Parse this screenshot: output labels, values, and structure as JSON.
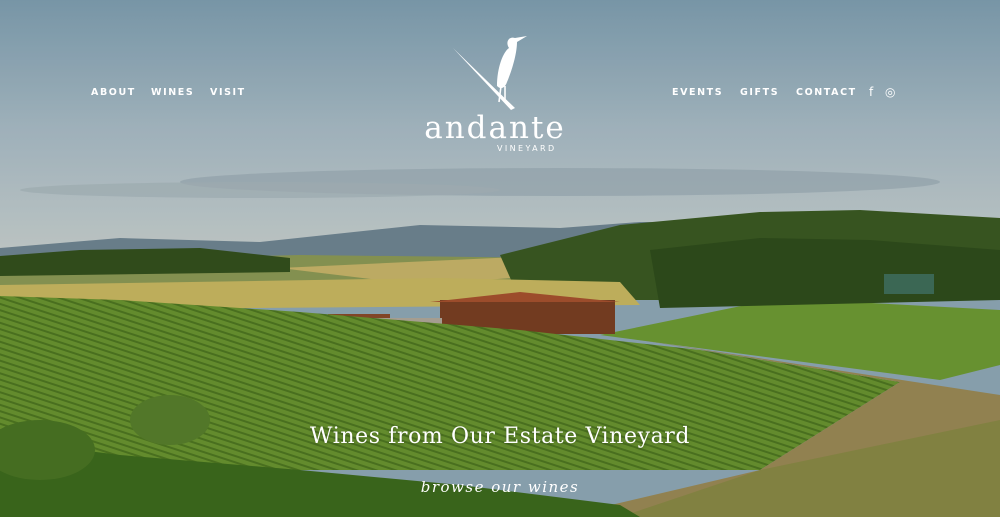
{
  "nav": {
    "left": [
      "ABOUT",
      "WINES",
      "VISIT"
    ],
    "right": [
      "EVENTS",
      "GIFTS",
      "CONTACT"
    ],
    "social": {
      "facebook": "f",
      "instagram": "◎"
    }
  },
  "brand": {
    "name": "andante",
    "subtitle": "VINEYARD",
    "logo_icon": "heron-icon"
  },
  "hero": {
    "tagline": "Wines from Our Estate Vineyard",
    "cta": "browse our wines"
  },
  "colors": {
    "sky": "#8fa8b6",
    "vine": "#5f8a2c",
    "text": "#ffffff"
  }
}
